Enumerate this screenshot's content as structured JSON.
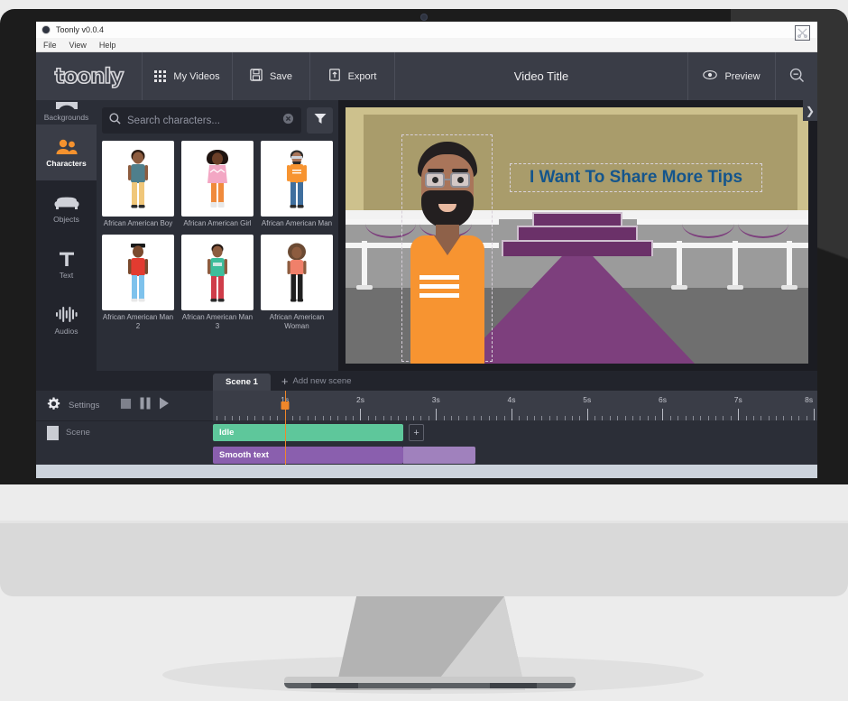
{
  "window": {
    "title": "Toonly v0.0.4",
    "menus": [
      "File",
      "View",
      "Help"
    ]
  },
  "toolbar": {
    "logo": "toonly",
    "my_videos": "My Videos",
    "save": "Save",
    "export": "Export",
    "video_title": "Video Title",
    "preview": "Preview",
    "zoom_icon": "zoom-out-icon"
  },
  "sidebar": {
    "items": [
      {
        "label": "Backgrounds",
        "icon": "backgrounds-icon",
        "active": false
      },
      {
        "label": "Characters",
        "icon": "characters-icon",
        "active": true
      },
      {
        "label": "Objects",
        "icon": "objects-icon",
        "active": false
      },
      {
        "label": "Text",
        "icon": "text-icon",
        "active": false
      },
      {
        "label": "Audios",
        "icon": "audios-icon",
        "active": false
      }
    ]
  },
  "library": {
    "search": {
      "placeholder": "Search characters...",
      "value": "",
      "search_icon": "search-icon",
      "clear_icon": "clear-icon"
    },
    "filter_icon": "filter-icon",
    "characters": [
      {
        "name": "African American Boy",
        "skin": "#8d5c3f",
        "hair": "#2b1b12",
        "top": "#4f7f8c",
        "bottom": "#f0c77a"
      },
      {
        "name": "African American Girl",
        "skin": "#6b3f28",
        "hair": "#1f1410",
        "top": "#f3a7c4",
        "bottom": "#f08a3c"
      },
      {
        "name": "African American Man",
        "skin": "#a9755a",
        "hair": "#2b2b2b",
        "top": "#f79431",
        "bottom": "#3f6f9e"
      },
      {
        "name": "African American Man 2",
        "skin": "#7a4a2e",
        "hair": "#1a1a1a",
        "top": "#e23b30",
        "bottom": "#7ec2ec"
      },
      {
        "name": "African American Man 3",
        "skin": "#8d5c3f",
        "hair": "#241812",
        "top": "#3dbd9b",
        "bottom": "#cf3d4a"
      },
      {
        "name": "African American Woman",
        "skin": "#8d5c3f",
        "hair": "#6b4a33",
        "top": "#f0806a",
        "bottom": "#1f1f1f"
      }
    ]
  },
  "stage": {
    "text_element": "I Want To Share More Tips",
    "text_color": "#14558c",
    "next_arrow_icon": "chevron-right-icon",
    "selected_character": "African American Man"
  },
  "timeline": {
    "scene_tab": "Scene 1",
    "add_scene": "Add new scene",
    "settings_label": "Settings",
    "controls": [
      "stop-icon",
      "pause-icon",
      "play-icon"
    ],
    "ruler_ticks": [
      "1s",
      "2s",
      "3s",
      "4s",
      "5s",
      "6s",
      "7s",
      "8s"
    ],
    "playhead_time": "1s",
    "tracks": [
      {
        "name": "Idle",
        "color": "#5ec79b",
        "start_s": 0.0,
        "end_s": 2.55,
        "add_label": "+"
      },
      {
        "name": "Smooth text",
        "color": "#8a5fae",
        "start_s": 0.0,
        "end_s": 2.55
      }
    ],
    "scene_row_label": "Scene",
    "cut_icon": "cut-icon"
  }
}
